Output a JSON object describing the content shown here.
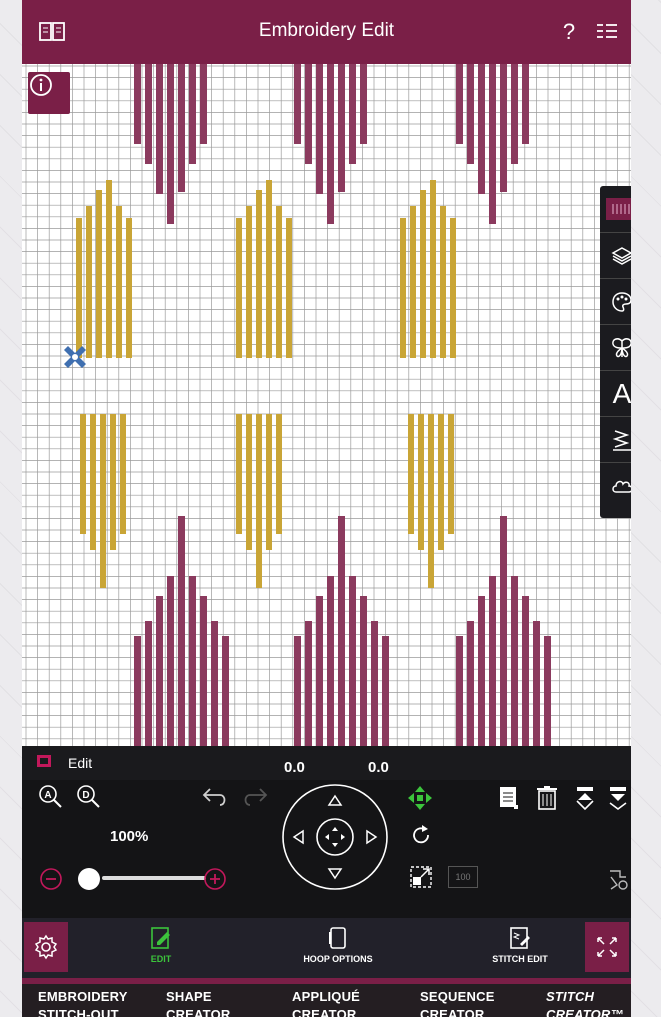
{
  "header": {
    "title": "Embroidery Edit",
    "help_label": "?"
  },
  "edit_panel": {
    "label": "Edit",
    "x_value": "0.0",
    "y_value": "0.0",
    "zoom_label": "100%",
    "zoom_percent": 100,
    "scale_badge": "100"
  },
  "bottom_tabs": [
    {
      "label": "EDIT",
      "active": true
    },
    {
      "label": "HOOP OPTIONS",
      "active": false
    },
    {
      "label": "STITCH EDIT",
      "active": false
    }
  ],
  "sections": [
    {
      "line1": "EMBROIDERY",
      "line2": "STITCH-OUT"
    },
    {
      "line1": "SHAPE",
      "line2": "CREATOR"
    },
    {
      "line1": "APPLIQUÉ",
      "line2": "CREATOR"
    },
    {
      "line1": "SEQUENCE",
      "line2": "CREATOR"
    },
    {
      "line1": "STITCH",
      "line2": "CREATOR™"
    }
  ],
  "side_toolbar": {
    "text_tool_label": "A"
  },
  "colors": {
    "accent": "#7a1f47",
    "thread_maroon": "#8b3a5e",
    "thread_gold": "#c9a536",
    "active_green": "#3cc43c"
  }
}
